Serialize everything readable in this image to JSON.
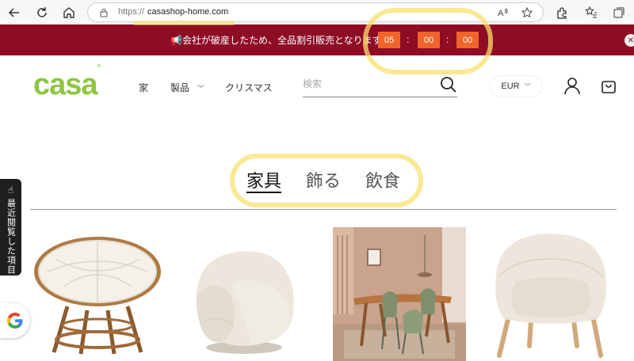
{
  "browser": {
    "url_protocol": "https://",
    "url_host": "casashop-home.com",
    "icons": [
      "back-icon",
      "reload-icon",
      "home-icon",
      "lock-icon",
      "read-aloud-icon",
      "favorite-icon",
      "extensions-icon",
      "favorites-bar-icon",
      "collections-icon"
    ]
  },
  "promo": {
    "text": "📢会社が破産したため、全品割引販売となります！",
    "countdown": {
      "hours": "05",
      "minutes": "00",
      "seconds": "00",
      "separator": ":"
    },
    "background": "#8e0d25",
    "box_color": "#f0642a"
  },
  "header": {
    "logo_text": "casa",
    "logo_mark": "®",
    "brand_color": "#8cc63f",
    "nav": {
      "home": "家",
      "products": "製品",
      "christmas": "クリスマス"
    },
    "search_placeholder": "検索",
    "currency": "EUR"
  },
  "tabs": {
    "furniture": "家具",
    "decor": "飾る",
    "dining": "飲食",
    "active": "家具"
  },
  "side": {
    "recent_label": "最近閲覧した項目"
  },
  "products": [
    {
      "name": "papasan-chair",
      "icon": "round-rattan-chair"
    },
    {
      "name": "boucle-armchair",
      "icon": "boucle-armchair"
    },
    {
      "name": "dining-set",
      "icon": "dining-room-photo"
    },
    {
      "name": "boucle-wood-leg-chair",
      "icon": "boucle-chair-wood-legs"
    }
  ]
}
